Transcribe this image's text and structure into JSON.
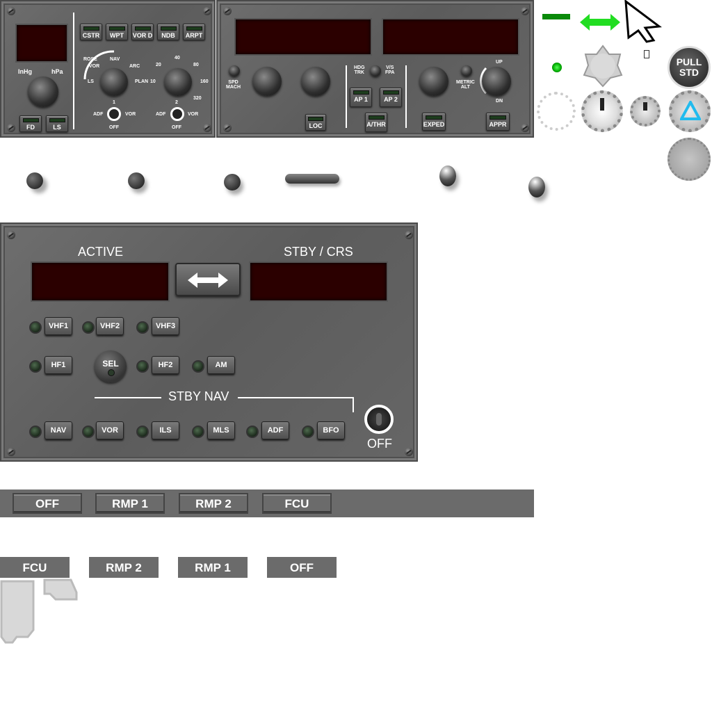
{
  "efis": {
    "baro_units": [
      "InHg",
      "hPa"
    ],
    "buttons_top": [
      "CSTR",
      "WPT",
      "VOR D",
      "NDB",
      "ARPT"
    ],
    "buttons_bottom": [
      "FD",
      "LS"
    ],
    "mode_labels": [
      "ROSE",
      "NAV",
      "VOR",
      "ARC",
      "LS",
      "PLAN"
    ],
    "range_labels": [
      "20",
      "40",
      "80",
      "10",
      "160",
      "320"
    ],
    "adf1": {
      "left": "ADF",
      "num": "1",
      "right": "VOR",
      "off": "OFF"
    },
    "adf2": {
      "left": "ADF",
      "num": "2",
      "right": "VOR",
      "off": "OFF"
    }
  },
  "fcu": {
    "spd_mach": "SPD\nMACH",
    "hdg_trk": "HDG\nTRK",
    "vs_fpa": "V/S\nFPA",
    "metric_alt": "METRIC\nALT",
    "up": "UP",
    "dn": "DN",
    "buttons": {
      "loc": "LOC",
      "ap1": "AP 1",
      "ap2": "AP 2",
      "athr": "A/THR",
      "exped": "EXPED",
      "appr": "APPR"
    }
  },
  "extras": {
    "pull_std": "PULL\nSTD"
  },
  "rmp": {
    "active_label": "ACTIVE",
    "stby_label": "STBY / CRS",
    "row1": [
      "VHF1",
      "VHF2",
      "VHF3"
    ],
    "row2_left": "HF1",
    "sel": "SEL",
    "row2_right": [
      "HF2",
      "AM"
    ],
    "stby_nav": "STBY NAV",
    "row3": [
      "NAV",
      "VOR",
      "ILS",
      "MLS",
      "ADF",
      "BFO"
    ],
    "off": "OFF"
  },
  "bar1": [
    "OFF",
    "RMP 1",
    "RMP 2",
    "FCU"
  ],
  "bar2": [
    "FCU",
    "RMP 2",
    "RMP 1",
    "OFF"
  ],
  "colors": {
    "accent_green": "#22dd22",
    "display_bg": "#2b0000",
    "panel": "#636363",
    "pull_std_triangle": "#22bbee"
  }
}
